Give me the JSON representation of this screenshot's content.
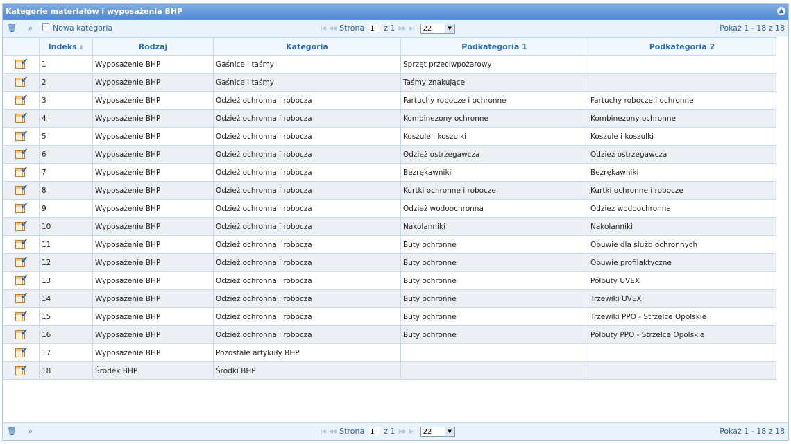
{
  "panel": {
    "title": "Kategorie materiałów i wyposażenia BHP"
  },
  "toolbar": {
    "delete_icon": "trash-icon",
    "search_icon": "search-icon",
    "new_category_label": "Nowa kategoria"
  },
  "pager": {
    "page_label": "Strona",
    "page_value": "1",
    "of_label": "z 1",
    "rows_per_page": "22",
    "records": "Pokaż 1 - 18 z 18"
  },
  "columns": {
    "index": "Indeks",
    "type": "Rodzaj",
    "category": "Kategoria",
    "sub1": "Podkategoria 1",
    "sub2": "Podkategoria 2"
  },
  "rows": [
    {
      "idx": "1",
      "type": "Wyposażenie BHP",
      "cat": "Gaśnice i taśmy",
      "sub1": "Sprzęt przeciwpożarowy",
      "sub2": ""
    },
    {
      "idx": "2",
      "type": "Wyposażenie BHP",
      "cat": "Gaśnice i taśmy",
      "sub1": "Taśmy znakujące",
      "sub2": ""
    },
    {
      "idx": "3",
      "type": "Wyposażenie BHP",
      "cat": "Odzież ochronna i robocza",
      "sub1": "Fartuchy robocze i ochronne",
      "sub2": "Fartuchy robocze i ochronne"
    },
    {
      "idx": "4",
      "type": "Wyposażenie BHP",
      "cat": "Odzież ochronna i robocza",
      "sub1": "Kombinezony ochronne",
      "sub2": "Kombinezony ochronne"
    },
    {
      "idx": "5",
      "type": "Wyposażenie BHP",
      "cat": "Odzież ochronna i robocza",
      "sub1": "Koszule i koszulki",
      "sub2": "Koszule i koszulki"
    },
    {
      "idx": "6",
      "type": "Wyposażenie BHP",
      "cat": "Odzież ochronna i robocza",
      "sub1": "Odzież ostrzegawcza",
      "sub2": "Odzież ostrzegawcza"
    },
    {
      "idx": "7",
      "type": "Wyposażenie BHP",
      "cat": "Odzież ochronna i robocza",
      "sub1": "Bezrękawniki",
      "sub2": "Bezrękawniki"
    },
    {
      "idx": "8",
      "type": "Wyposażenie BHP",
      "cat": "Odzież ochronna i robocza",
      "sub1": "Kurtki ochronne i robocze",
      "sub2": "Kurtki ochronne i robocze"
    },
    {
      "idx": "9",
      "type": "Wyposażenie BHP",
      "cat": "Odzież ochronna i robocza",
      "sub1": "Odzież wodoochronna",
      "sub2": "Odzież wodoochronna"
    },
    {
      "idx": "10",
      "type": "Wyposażenie BHP",
      "cat": "Odzież ochronna i robocza",
      "sub1": "Nakolanniki",
      "sub2": "Nakolanniki"
    },
    {
      "idx": "11",
      "type": "Wyposażenie BHP",
      "cat": "Odzież ochronna i robocza",
      "sub1": "Buty ochronne",
      "sub2": "Obuwie dla służb ochronnych"
    },
    {
      "idx": "12",
      "type": "Wyposażenie BHP",
      "cat": "Odzież ochronna i robocza",
      "sub1": "Buty ochronne",
      "sub2": "Obuwie profilaktyczne"
    },
    {
      "idx": "13",
      "type": "Wyposażenie BHP",
      "cat": "Odzież ochronna i robocza",
      "sub1": "Buty ochronne",
      "sub2": "Półbuty UVEX"
    },
    {
      "idx": "14",
      "type": "Wyposażenie BHP",
      "cat": "Odzież ochronna i robocza",
      "sub1": "Buty ochronne",
      "sub2": "Trzewiki UVEX"
    },
    {
      "idx": "15",
      "type": "Wyposażenie BHP",
      "cat": "Odzież ochronna i robocza",
      "sub1": "Buty ochronne",
      "sub2": "Trzewiki PPO - Strzelce Opolskie"
    },
    {
      "idx": "16",
      "type": "Wyposażenie BHP",
      "cat": "Odzież ochronna i robocza",
      "sub1": "Buty ochronne",
      "sub2": "Półbuty PPO - Strzelce Opolskie"
    },
    {
      "idx": "17",
      "type": "Wyposażenie BHP",
      "cat": "Pozostałe artykuły BHP",
      "sub1": "",
      "sub2": ""
    },
    {
      "idx": "18",
      "type": "Środek BHP",
      "cat": "Środki BHP",
      "sub1": "",
      "sub2": ""
    }
  ]
}
